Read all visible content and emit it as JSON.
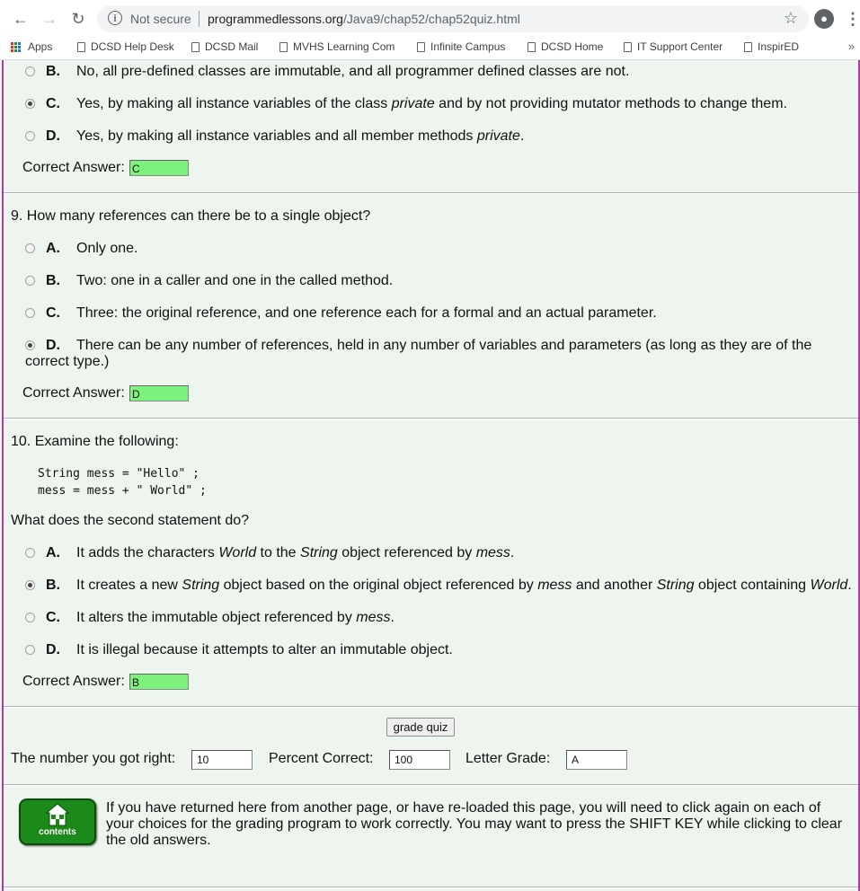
{
  "browser": {
    "security_label": "Not secure",
    "url_domain": "programmedlessons.org",
    "url_path": "/Java9/chap52/chap52quiz.html",
    "profile_icon": "profile-icon"
  },
  "bookmarks": [
    {
      "label": "Apps"
    },
    {
      "label": "DCSD Help Desk"
    },
    {
      "label": "DCSD Mail"
    },
    {
      "label": "MVHS Learning Com"
    },
    {
      "label": "Infinite Campus"
    },
    {
      "label": "DCSD Home"
    },
    {
      "label": "IT Support Center"
    },
    {
      "label": "InspirED"
    }
  ],
  "bookmarks_more": "»",
  "q8": {
    "options": [
      {
        "letter": "B.",
        "text": "No, all pre-defined classes are immutable, and all programmer defined classes are not.",
        "selected": false
      },
      {
        "letter": "C.",
        "text_parts": [
          "Yes, by making all instance variables of the class ",
          "private",
          " and by not providing mutator methods to change them."
        ],
        "selected": true
      },
      {
        "letter": "D.",
        "text_parts": [
          "Yes, by making all instance variables and all member methods ",
          "private",
          "."
        ],
        "selected": false
      }
    ],
    "answer_label": "Correct Answer:",
    "answer": "C"
  },
  "q9": {
    "question": "9. How many references can there be to a single object?",
    "options": [
      {
        "letter": "A.",
        "text": "Only one.",
        "selected": false
      },
      {
        "letter": "B.",
        "text": "Two: one in a caller and one in the called method.",
        "selected": false
      },
      {
        "letter": "C.",
        "text": "Three: the original reference, and one reference each for a formal and an actual parameter.",
        "selected": false
      },
      {
        "letter": "D.",
        "text": "There can be any number of references, held in any number of variables and parameters (as long as they are of the",
        "wrap": "correct type.)",
        "selected": true
      }
    ],
    "answer_label": "Correct Answer:",
    "answer": "D"
  },
  "q10": {
    "question": "10. Examine the following:",
    "code_line1": "String mess = \"Hello\" ;",
    "code_line2": "mess = mess + \" World\" ;",
    "prompt": "What does the second statement do?",
    "options": [
      {
        "letter": "A.",
        "text_parts": [
          "It adds the characters ",
          "World",
          " to the ",
          "String",
          " object referenced by ",
          "mess",
          "."
        ],
        "selected": false
      },
      {
        "letter": "B.",
        "text_parts": [
          "It creates a new ",
          "String",
          " object based on the original object referenced by ",
          "mess",
          " and another ",
          "String",
          " object containing ",
          "World",
          "."
        ],
        "selected": true
      },
      {
        "letter": "C.",
        "text_parts": [
          "It alters the immutable object referenced by ",
          "mess",
          "."
        ],
        "selected": false
      },
      {
        "letter": "D.",
        "text": "It is illegal because it attempts to alter an immutable object.",
        "selected": false
      }
    ],
    "answer_label": "Correct Answer:",
    "answer": "B"
  },
  "grading": {
    "button_label": "grade quiz",
    "right_label": "The number you got right:",
    "right_value": "10",
    "percent_label": "Percent Correct:",
    "percent_value": "100",
    "grade_label": "Letter Grade:",
    "grade_value": "A"
  },
  "footer": {
    "contents_label": "contents",
    "note": "If you have returned here from another page, or have re-loaded this page, you will need to click again on each of your choices for the grading program to work correctly. You may want to press the SHIFT KEY while clicking to clear the old answers."
  },
  "colors": {
    "page_bg": "#eef4ee",
    "frame_border": "#b039b0",
    "answer_bg": "#7cf27c",
    "contents_bg": "#1b8a1b"
  }
}
